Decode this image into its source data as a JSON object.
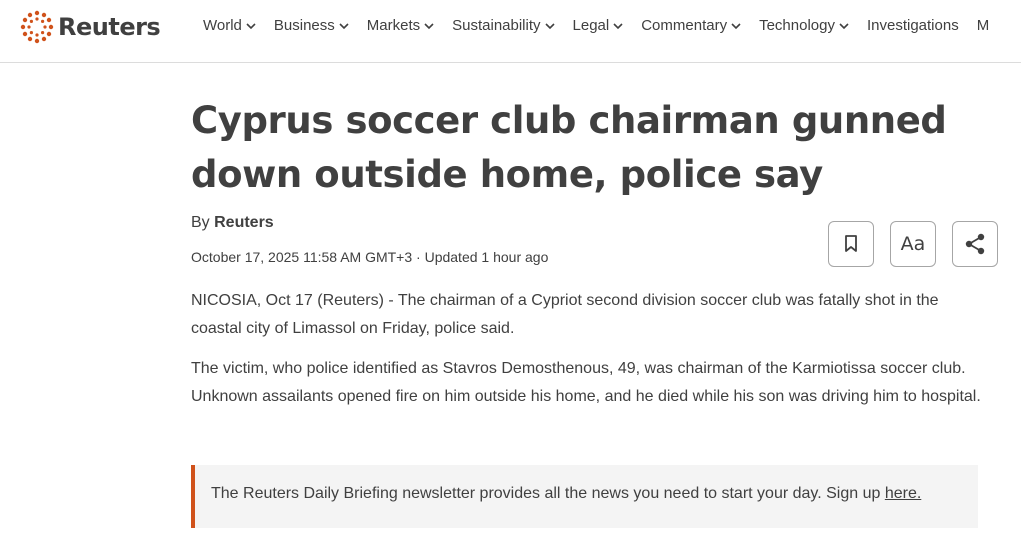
{
  "header": {
    "logo_text": "Reuters",
    "brand_color": "#d0521b",
    "nav": [
      {
        "label": "World",
        "has_dropdown": true
      },
      {
        "label": "Business",
        "has_dropdown": true
      },
      {
        "label": "Markets",
        "has_dropdown": true
      },
      {
        "label": "Sustainability",
        "has_dropdown": true
      },
      {
        "label": "Legal",
        "has_dropdown": true
      },
      {
        "label": "Commentary",
        "has_dropdown": true
      },
      {
        "label": "Technology",
        "has_dropdown": true
      },
      {
        "label": "Investigations",
        "has_dropdown": false
      },
      {
        "label": "M",
        "has_dropdown": false
      }
    ]
  },
  "article": {
    "headline": "Cyprus soccer club chairman gunned down outside home, police say",
    "byline_prefix": "By",
    "author": "Reuters",
    "dateline": "October 17, 2025 11:58 AM GMT+3 · Updated 1 hour ago",
    "paragraphs": [
      "NICOSIA, Oct 17 (Reuters) - The chairman of a Cypriot second division soccer club was fatally shot in the coastal city of Limassol on Friday, police said.",
      "The victim, who police identified as Stavros Demosthenous, 49, was chairman of the Karmiotissa soccer club. Unknown assailants opened fire on him outside his home, and he died while his son was driving him to hospital."
    ],
    "tools": {
      "bookmark_icon": "bookmark-icon",
      "font_size_label": "Aa",
      "share_icon": "share-icon"
    }
  },
  "newsletter": {
    "text": "The Reuters Daily Briefing newsletter provides all the news you need to start your day. Sign up ",
    "link_label": "here.",
    "accent_color": "#d0521b"
  }
}
